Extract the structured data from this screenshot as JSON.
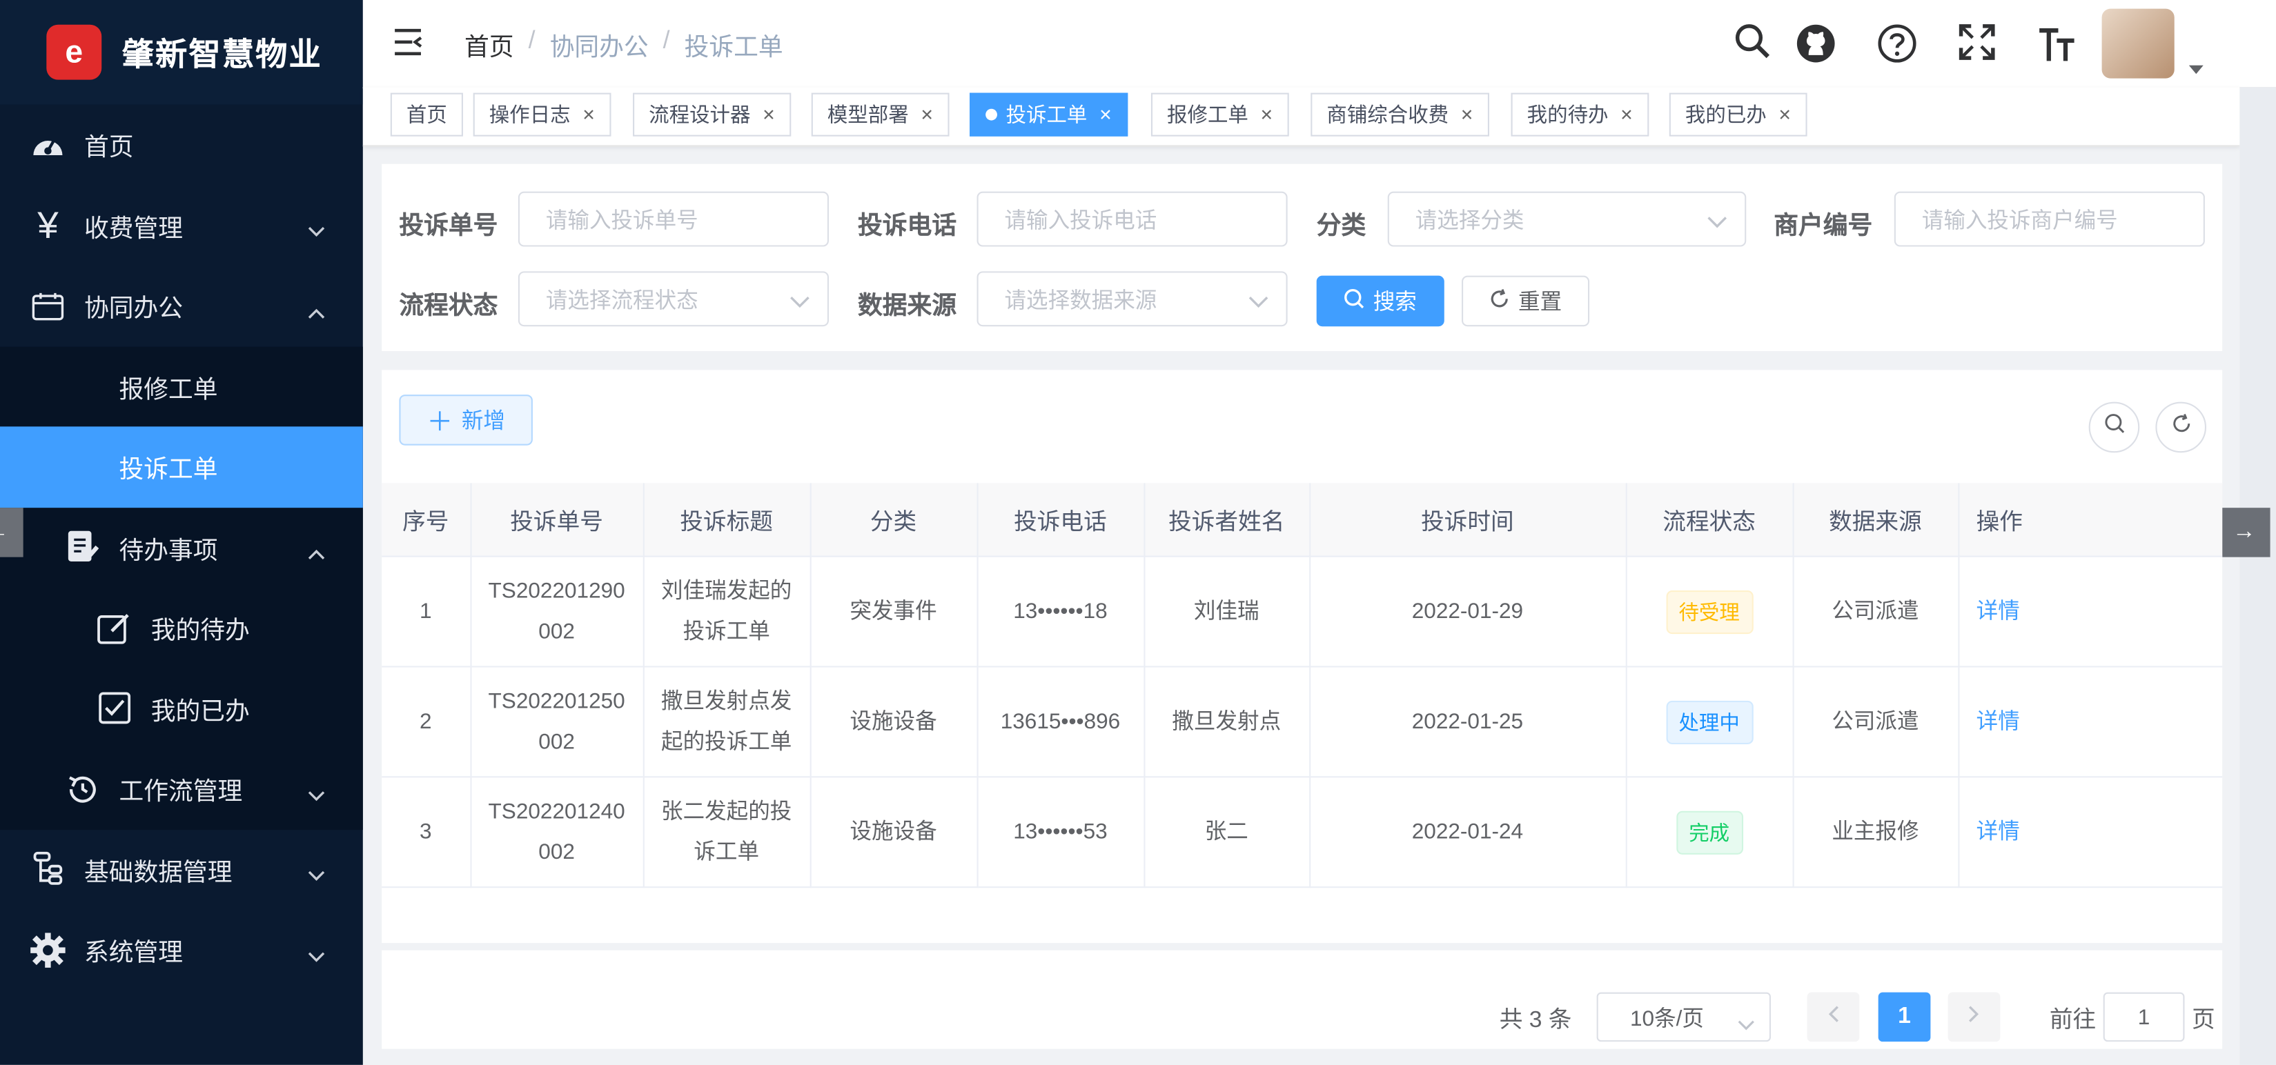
{
  "brand": {
    "title": "肇新智慧物业",
    "logo_char": "e"
  },
  "sidebar": {
    "items": [
      {
        "label": "首页"
      },
      {
        "label": "收费管理"
      },
      {
        "label": "协同办公"
      },
      {
        "label": "报修工单"
      },
      {
        "label": "投诉工单"
      },
      {
        "label": "待办事项"
      },
      {
        "label": "我的待办"
      },
      {
        "label": "我的已办"
      },
      {
        "label": "工作流管理"
      },
      {
        "label": "基础数据管理"
      },
      {
        "label": "系统管理"
      }
    ]
  },
  "header": {
    "breadcrumb": [
      "首页",
      "协同办公",
      "投诉工单"
    ],
    "separator": "/"
  },
  "tags": [
    "首页",
    "操作日志",
    "流程设计器",
    "模型部署",
    "投诉工单",
    "报修工单",
    "商铺综合收费",
    "我的待办",
    "我的已办"
  ],
  "filters": {
    "complaint_no": {
      "label": "投诉单号",
      "placeholder": "请输入投诉单号"
    },
    "phone": {
      "label": "投诉电话",
      "placeholder": "请输入投诉电话"
    },
    "category": {
      "label": "分类",
      "placeholder": "请选择分类"
    },
    "merchant_no": {
      "label": "商户编号",
      "placeholder": "请输入投诉商户编号"
    },
    "flow_status": {
      "label": "流程状态",
      "placeholder": "请选择流程状态"
    },
    "data_source": {
      "label": "数据来源",
      "placeholder": "请选择数据来源"
    },
    "search_label": "搜索",
    "reset_label": "重置"
  },
  "toolbar": {
    "add_label": "新增"
  },
  "table": {
    "columns": [
      "序号",
      "投诉单号",
      "投诉标题",
      "分类",
      "投诉电话",
      "投诉者姓名",
      "投诉时间",
      "流程状态",
      "数据来源",
      "操作"
    ],
    "rows": [
      {
        "index": "1",
        "no": "TS202201290002",
        "title": "刘佳瑞发起的投诉工单",
        "category": "突发事件",
        "phone": "13••••••18",
        "name": "刘佳瑞",
        "time": "2022-01-29",
        "status": "待受理",
        "source": "公司派遣",
        "action": "详情"
      },
      {
        "index": "2",
        "no": "TS202201250002",
        "title": "撒旦发射点发起的投诉工单",
        "category": "设施设备",
        "phone": "13615•••896",
        "name": "撒旦发射点",
        "time": "2022-01-25",
        "status": "处理中",
        "source": "公司派遣",
        "action": "详情"
      },
      {
        "index": "3",
        "no": "TS202201240002",
        "title": "张二发起的投诉工单",
        "category": "设施设备",
        "phone": "13••••••53",
        "name": "张二",
        "time": "2022-01-24",
        "status": "完成",
        "source": "业主报修",
        "action": "详情"
      }
    ]
  },
  "pagination": {
    "total_text": "共 3 条",
    "page_size": "10条/页",
    "current_page": "1",
    "goto_label": "前往",
    "goto_value": "1",
    "page_suffix": "页"
  },
  "colors": {
    "primary": "#409eff",
    "sidebar_bg": "#0a1a30",
    "warning": "#ffba00",
    "success": "#13ce66"
  }
}
